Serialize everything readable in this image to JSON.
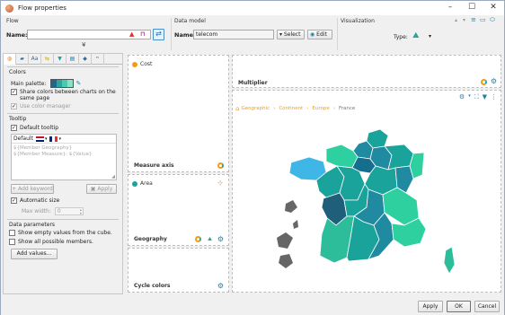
{
  "window": {
    "title": "Flow properties"
  },
  "top": {
    "flow_section": "Flow",
    "name_label": "Name:",
    "name_value": "",
    "data_model_section": "Data model",
    "model_name_label": "Name:",
    "model_name_value": "telecom",
    "select_label": "Select",
    "edit_label": "Edit",
    "visualization_section": "Visualization",
    "type_label": "Type:"
  },
  "left": {
    "colors_title": "Colors",
    "main_palette_label": "Main palette:",
    "palette_colors": [
      "#1a6b8a",
      "#2aa5a0",
      "#48c9b0",
      "#8be0c6"
    ],
    "share_colors_label": "Share colors between charts on the same page",
    "use_color_manager_label": "Use color manager",
    "tooltip_title": "Tooltip",
    "default_tooltip_label": "Default tooltip",
    "default_lang_label": "Default",
    "tooltip_line1": "${Member Geography}",
    "tooltip_line2": "${Member Measure}: ${Value}",
    "add_keyword_label": "Add keyword",
    "apply_small_label": "Apply",
    "automatic_size_label": "Automatic size",
    "max_width_label": "Max width:",
    "max_width_value": "0",
    "data_params_title": "Data parameters",
    "show_empty_label": "Show empty values from the cube.",
    "show_all_label": "Show all possible members.",
    "add_values_label": "Add values..."
  },
  "zones": {
    "cost_label": "Cost",
    "measure_axis_label": "Measure axis",
    "area_label": "Area",
    "geography_label": "Geography",
    "cycle_colors_label": "Cycle colors",
    "multiplier_label": "Multiplier"
  },
  "breadcrumb": [
    "Geographic",
    "Continent",
    "Europe",
    "France"
  ],
  "footer": {
    "apply_label": "Apply",
    "ok_label": "OK",
    "cancel_label": "Cancel"
  },
  "colors": {
    "accent_orange": "#f39c12",
    "teal_dark": "#1f5f7a",
    "teal_mid": "#1aa39a",
    "teal_light": "#2ed0a0",
    "sky": "#3fb7e6",
    "settings_blue": "#1f7fa6"
  }
}
